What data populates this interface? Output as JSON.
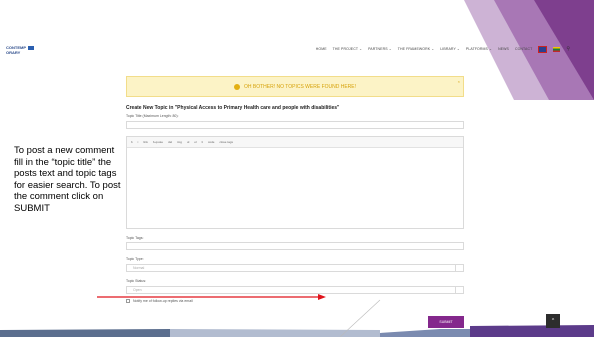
{
  "header": {
    "logo_line1": "CONTEMP",
    "logo_line2": "ORARY",
    "nav": [
      "HOME",
      "THE PROJECT ⌄",
      "PARTNERS ⌄",
      "THE FRAMEWORK ⌄",
      "LIBRARY ⌄",
      "PLATFORMS ⌄",
      "NEWS",
      "CONTACT"
    ]
  },
  "annotation": "To post a new comment fill in the “topic title” the posts text and topic tags for easier search. To post the comment click on SUBMIT",
  "notice": {
    "text": "OH BOTHER! NO TOPICS WERE FOUND HERE!",
    "close": "×"
  },
  "form": {
    "title": "Create New Topic in \"Physical Access to Primary Health care and people with disabilities\"",
    "topic_title_label": "Topic Title (Maximum Length: 80):",
    "toolbar": [
      "b",
      "i",
      "link",
      "b-quote",
      "del",
      "img",
      "ul",
      "ol",
      "li",
      "code",
      "close tags"
    ],
    "tags_label": "Topic Tags:",
    "type_label": "Topic Type:",
    "type_value": "Normal",
    "status_label": "Topic Status:",
    "status_value": "Open",
    "notify_label": "Notify me of follow-up replies via email",
    "submit": "SUBMIT"
  },
  "scroll_top": "^",
  "colors": {
    "accent_purple": "#84288c",
    "notice_bg": "#fcf3c6",
    "arrow_red": "#e0141c"
  }
}
